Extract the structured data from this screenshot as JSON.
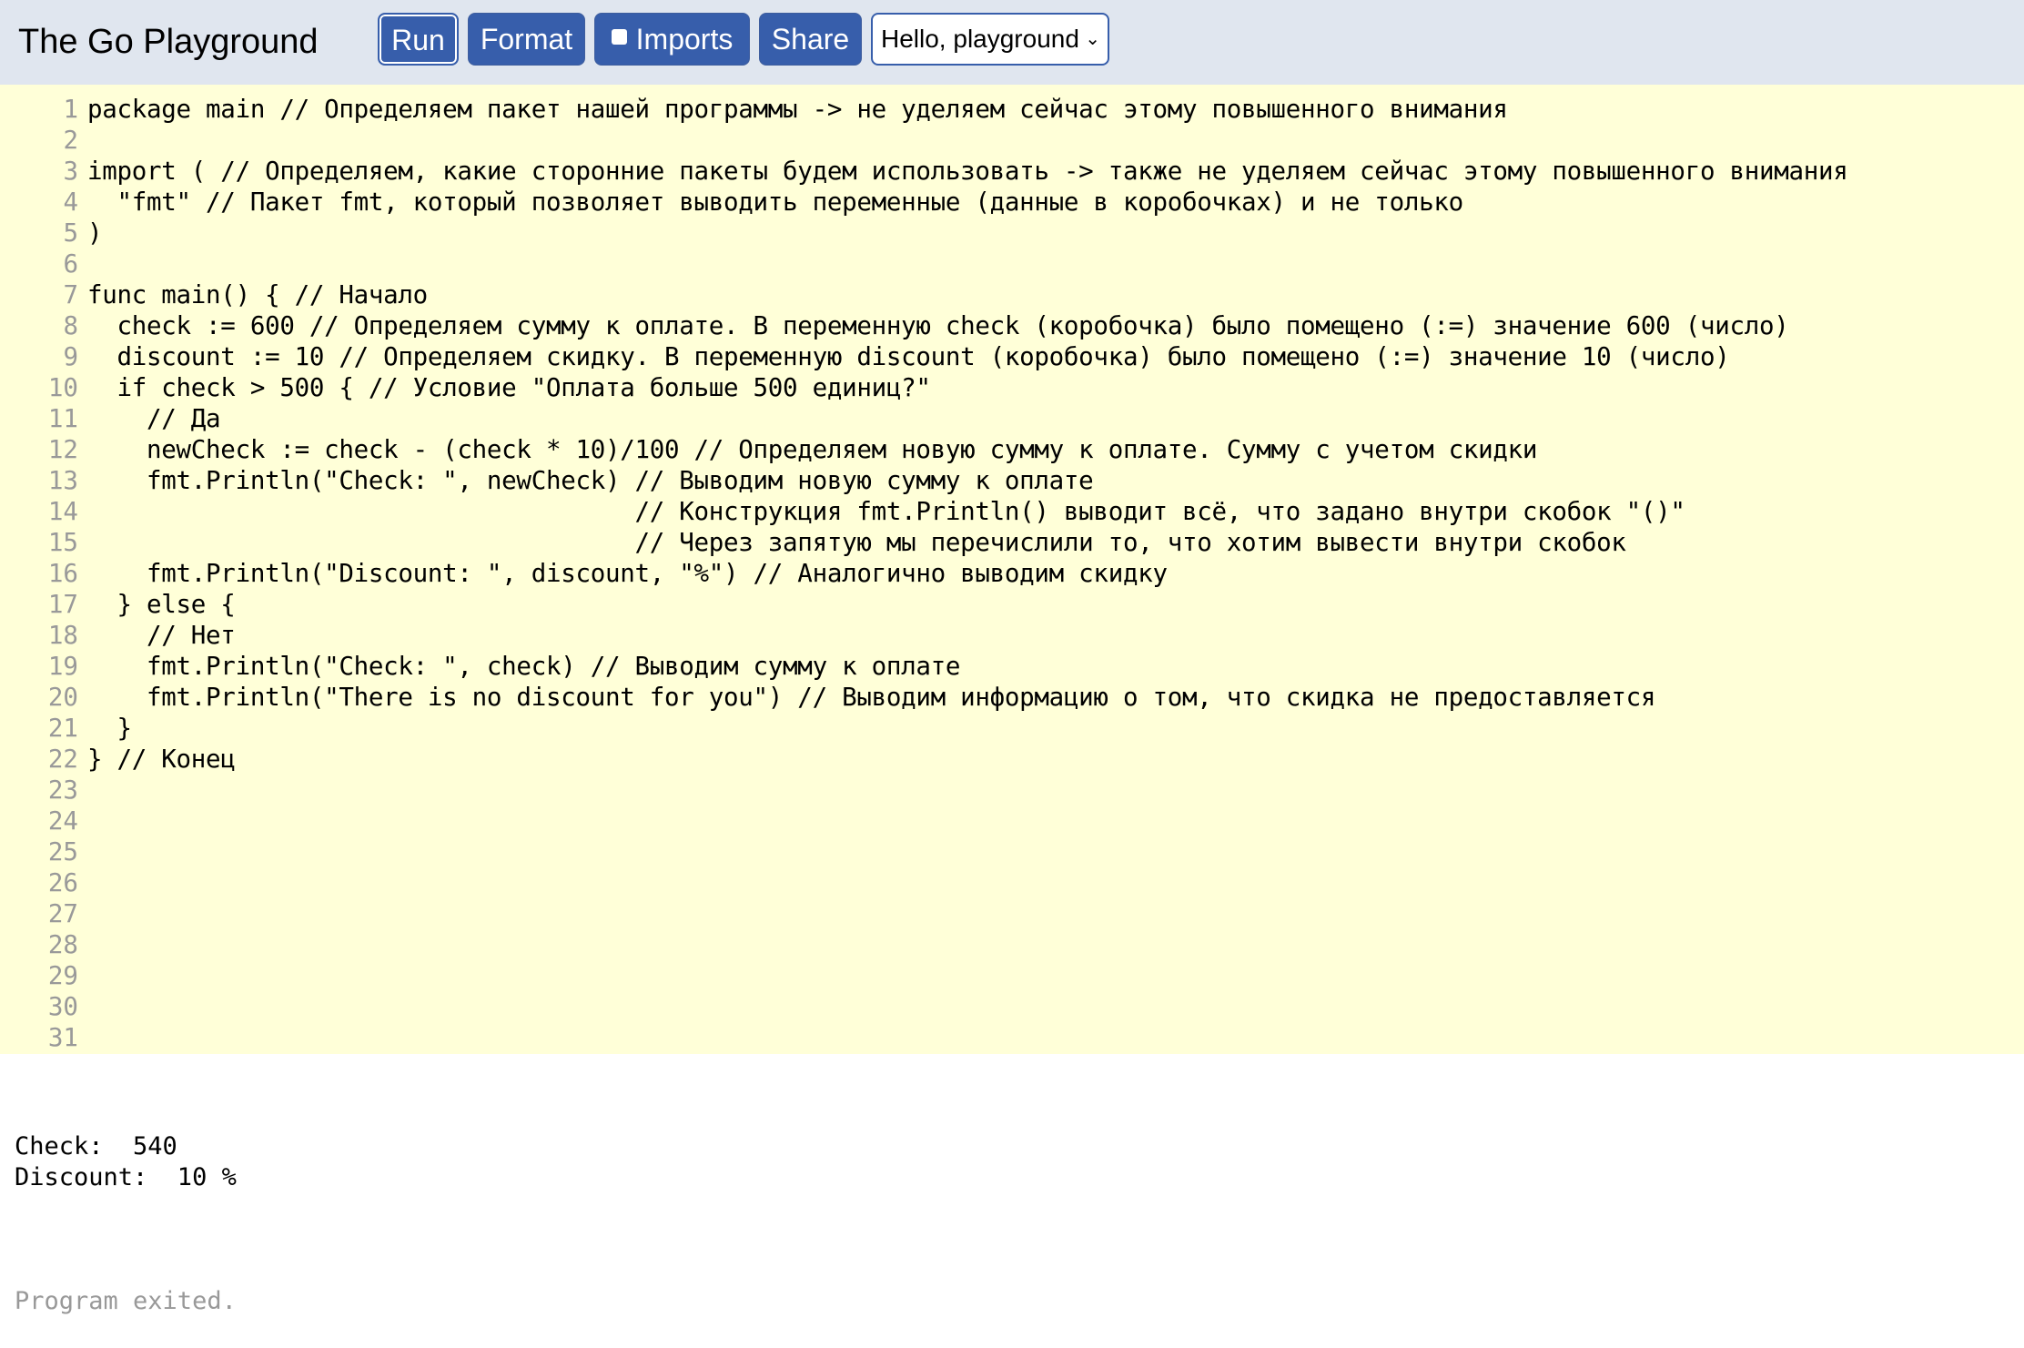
{
  "header": {
    "title": "The Go Playground",
    "run_label": "Run",
    "format_label": "Format",
    "imports_label": "Imports",
    "imports_checked": false,
    "share_label": "Share",
    "example_select": "Hello, playground"
  },
  "editor": {
    "lines": [
      {
        "n": "1",
        "code": "package main // Определяем пакет нашей программы -> не уделяем сейчас этому повышенного внимания"
      },
      {
        "n": "2",
        "code": ""
      },
      {
        "n": "3",
        "code": "import ( // Определяем, какие сторонние пакеты будем использовать -> также не уделяем сейчас этому повышенного внимания"
      },
      {
        "n": "4",
        "code": "  \"fmt\" // Пакет fmt, который позволяет выводить переменные (данные в коробочках) и не только"
      },
      {
        "n": "5",
        "code": ")"
      },
      {
        "n": "6",
        "code": ""
      },
      {
        "n": "7",
        "code": "func main() { // Начало"
      },
      {
        "n": "8",
        "code": "  check := 600 // Определяем сумму к оплате. В переменную check (коробочка) было помещено (:=) значение 600 (число)"
      },
      {
        "n": "9",
        "code": "  discount := 10 // Определяем скидку. В переменную discount (коробочка) было помещено (:=) значение 10 (число)"
      },
      {
        "n": "10",
        "code": "  if check > 500 { // Условие \"Оплата больше 500 единиц?\""
      },
      {
        "n": "11",
        "code": "    // Да"
      },
      {
        "n": "12",
        "code": "    newCheck := check - (check * 10)/100 // Определяем новую сумму к оплате. Сумму с учетом скидки"
      },
      {
        "n": "13",
        "code": "    fmt.Println(\"Check: \", newCheck) // Выводим новую сумму к оплате"
      },
      {
        "n": "14",
        "code": "                                     // Конструкция fmt.Println() выводит всё, что задано внутри скобок \"()\""
      },
      {
        "n": "15",
        "code": "                                     // Через запятую мы перечислили то, что хотим вывести внутри скобок"
      },
      {
        "n": "16",
        "code": "    fmt.Println(\"Discount: \", discount, \"%\") // Аналогично выводим скидку"
      },
      {
        "n": "17",
        "code": "  } else {"
      },
      {
        "n": "18",
        "code": "    // Нет"
      },
      {
        "n": "19",
        "code": "    fmt.Println(\"Check: \", check) // Выводим сумму к оплате"
      },
      {
        "n": "20",
        "code": "    fmt.Println(\"There is no discount for you\") // Выводим информацию о том, что скидка не предоставляется"
      },
      {
        "n": "21",
        "code": "  }"
      },
      {
        "n": "22",
        "code": "} // Конец"
      },
      {
        "n": "23",
        "code": ""
      },
      {
        "n": "24",
        "code": ""
      },
      {
        "n": "25",
        "code": ""
      },
      {
        "n": "26",
        "code": ""
      },
      {
        "n": "27",
        "code": ""
      },
      {
        "n": "28",
        "code": ""
      },
      {
        "n": "29",
        "code": ""
      },
      {
        "n": "30",
        "code": ""
      },
      {
        "n": "31",
        "code": ""
      }
    ]
  },
  "output": {
    "lines": [
      "Check:  540",
      "Discount:  10 %"
    ],
    "exit_status": "Program exited."
  }
}
